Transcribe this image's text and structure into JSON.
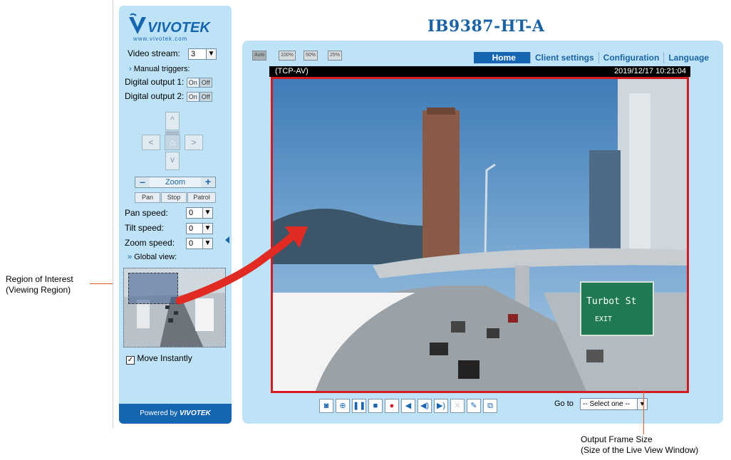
{
  "page": {
    "title": "IB9387-HT-A"
  },
  "brand": {
    "logo_text": "VIVOTEK",
    "logo_url_text": "www.vivotek.com",
    "powered_by": "Powered by",
    "powered_brand": "VIVOTEK"
  },
  "left_panel": {
    "video_stream_label": "Video stream:",
    "video_stream_value": "3",
    "manual_triggers_label": "Manual triggers:",
    "digital_output_1_label": "Digital output 1:",
    "digital_output_2_label": "Digital output 2:",
    "on_label": "On",
    "off_label": "Off",
    "zoom_label": "Zoom",
    "zoom_minus": "–",
    "zoom_plus": "+",
    "pan_label": "Pan",
    "stop_label": "Stop",
    "patrol_label": "Patrol",
    "pan_speed_label": "Pan speed:",
    "pan_speed_value": "0",
    "tilt_speed_label": "Tilt speed:",
    "tilt_speed_value": "0",
    "zoom_speed_label": "Zoom speed:",
    "zoom_speed_value": "0",
    "global_view_label": "Global view:",
    "move_instantly_label": "Move Instantly",
    "move_instantly_checked": true
  },
  "view_size_buttons": [
    "Auto",
    "100%",
    "50%",
    "25%"
  ],
  "nav": {
    "items": [
      {
        "label": "Home",
        "active": true
      },
      {
        "label": "Client settings",
        "active": false
      },
      {
        "label": "Configuration",
        "active": false
      },
      {
        "label": "Language",
        "active": false
      }
    ]
  },
  "video": {
    "protocol": "(TCP-AV)",
    "timestamp": "2019/12/17 10:21:04",
    "sign_text_1": "Turbot St",
    "sign_text_2": "EXIT"
  },
  "toolbar": {
    "icons": [
      "snapshot-icon",
      "digital-zoom-icon",
      "pause-icon",
      "stop-icon",
      "record-icon",
      "volume-icon",
      "speaker-icon",
      "talk-icon",
      "mute-icon",
      "microphone-mute-icon",
      "fullscreen-icon"
    ],
    "goto_label": "Go to",
    "goto_value": "-- Select one --"
  },
  "annotations": {
    "roi_line1": "Region of Interest",
    "roi_line2": "(Viewing Region)",
    "output_line1": "Output Frame Size",
    "output_line2": "(Size of the Live View Window)"
  },
  "colors": {
    "panel_bg": "#bfe3f6",
    "brand_blue": "#1565b1",
    "frame_red": "#d71920",
    "annotation_line": "#e05a28",
    "arrow_red": "#e02a22"
  }
}
